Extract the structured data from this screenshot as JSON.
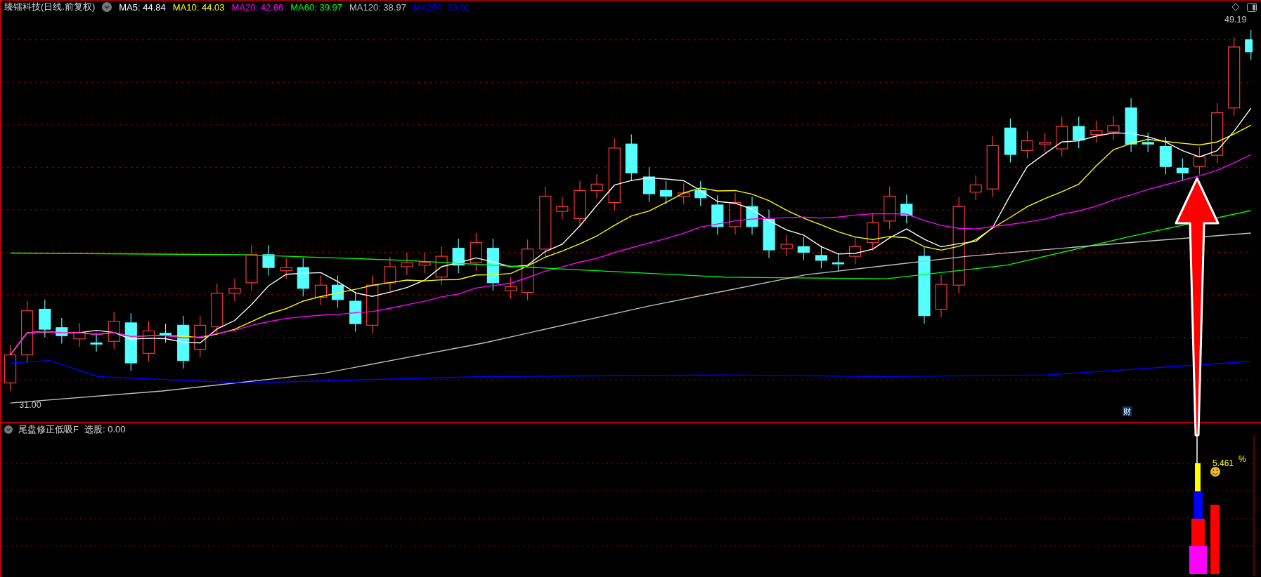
{
  "header": {
    "title": "臻镭科技(日线.前复权)",
    "moving_averages": [
      {
        "text": "MA5: 44.84",
        "color": "#ffffff"
      },
      {
        "text": "MA10: 44.03",
        "color": "#ffff00"
      },
      {
        "text": "MA20: 42.66",
        "color": "#ff00ff"
      },
      {
        "text": "MA60: 39.97",
        "color": "#00ff00"
      },
      {
        "text": "MA120: 38.97",
        "color": "#c0c0c0"
      },
      {
        "text": "MA250: 33.01",
        "color": "#0000ff"
      }
    ]
  },
  "price_chart": {
    "high_label": "49.19",
    "low_label": "31.00",
    "badge": "财"
  },
  "indicator": {
    "title": "尾盘修正低吸F",
    "reading": "选股: 0.00",
    "value": "5.461",
    "unit": "%"
  }
}
